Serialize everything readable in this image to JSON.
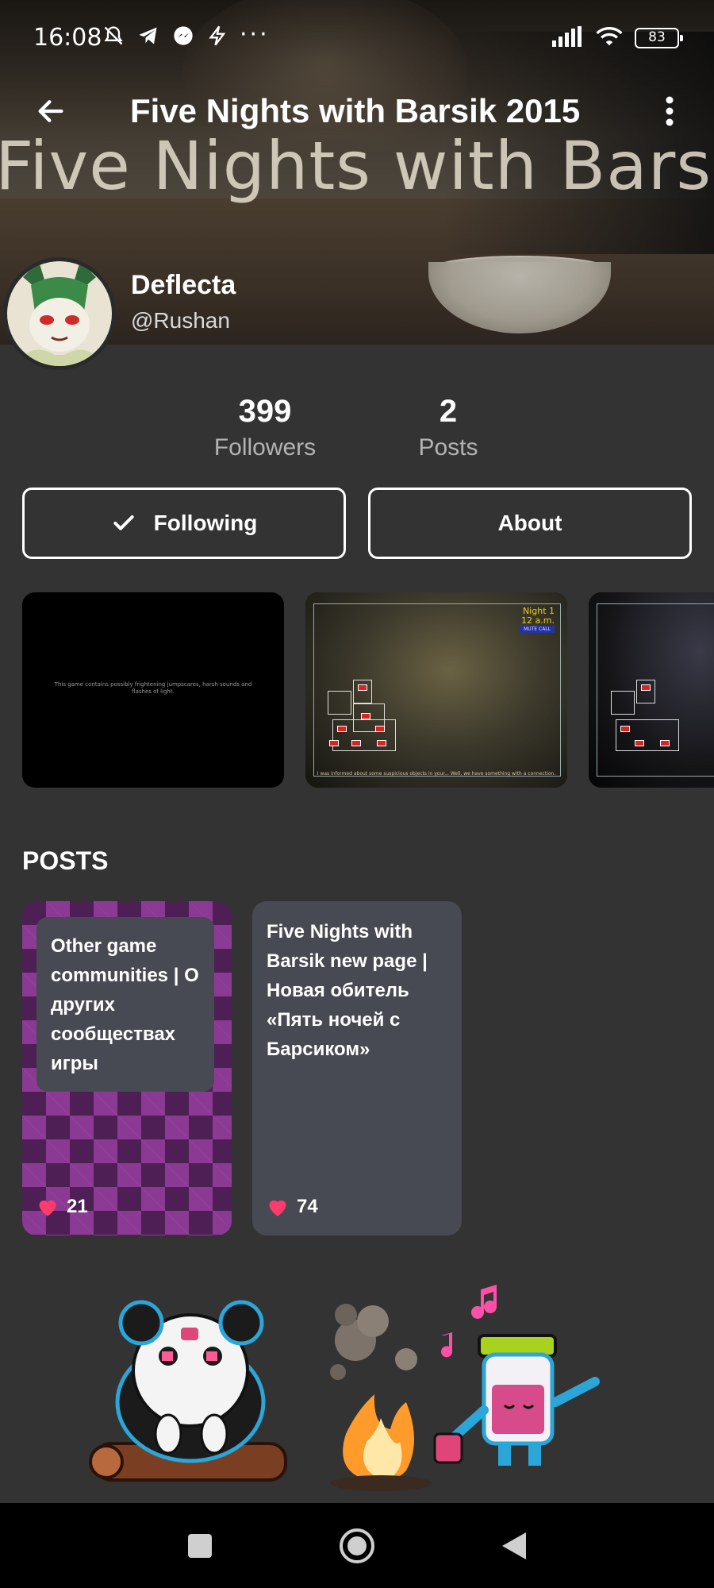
{
  "status_bar": {
    "time": "16:08",
    "more": "···",
    "battery": "83"
  },
  "app_bar": {
    "title": "Five Nights with Barsik 2015",
    "banner_text": "Five Nights with Barsik"
  },
  "profile": {
    "name": "Deflecta",
    "handle": "@Rushan"
  },
  "stats": {
    "followers_count": "399",
    "followers_label": "Followers",
    "posts_count": "2",
    "posts_label": "Posts"
  },
  "actions": {
    "following_label": "Following",
    "about_label": "About"
  },
  "screenshots": {
    "warning_text": "This game contains possibly frightening jumpscares, harsh sounds and flashes of light.",
    "cam_night": "Night 1",
    "cam_time": "12 a.m.",
    "cam_mute": "MUTE CALL",
    "cam_caption": "I was informed about some suspicious objects in your... Well, we have something with a connection."
  },
  "posts": {
    "heading": "POSTS",
    "items": [
      {
        "title": "Other game communities | О других сообществах игры",
        "likes": "21"
      },
      {
        "title": "Five Nights with Barsik new page | Новая обитель «Пять ночей с Барсиком»",
        "likes": "74"
      }
    ]
  },
  "colors": {
    "background": "#333333",
    "card": "#474a52",
    "heart": "#ff3b6b",
    "accent_purple": "#4d1f55"
  }
}
